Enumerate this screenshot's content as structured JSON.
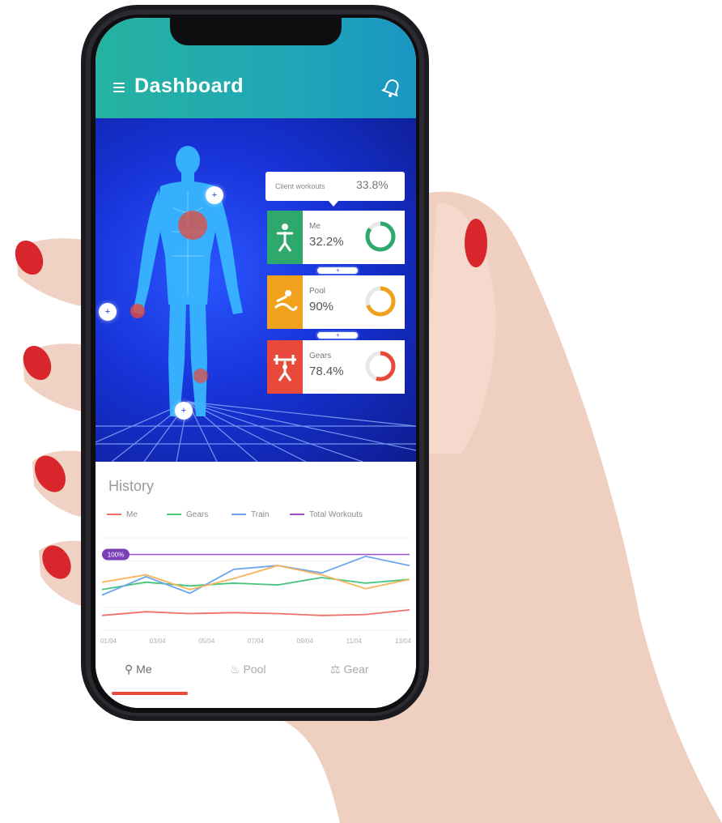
{
  "app": {
    "title": "Dashboard"
  },
  "header": {
    "menu_icon": "hamburger-menu-icon",
    "action_icon": "bell-icon"
  },
  "body_map": {
    "pins": [
      "+",
      "+",
      "+"
    ]
  },
  "tooltip": {
    "label": "Client workouts",
    "value": "33.8%"
  },
  "stats": [
    {
      "label": "Me",
      "value": "32.2%",
      "color": "#2ea86b",
      "icon": "figure-icon",
      "ring_fraction": 0.85
    },
    {
      "label": "Pool",
      "value": "90%",
      "color": "#f0a21c",
      "icon": "swimming-icon",
      "ring_fraction": 0.7
    },
    {
      "label": "Gears",
      "value": "78.4%",
      "color": "#e8493a",
      "icon": "weightlift-icon",
      "ring_fraction": 0.55
    }
  ],
  "connectors": [
    "+",
    "+"
  ],
  "history": {
    "title": "History",
    "legend": [
      {
        "name": "Me",
        "color": "#ef6f6a"
      },
      {
        "name": "Gears",
        "color": "#45c47a"
      },
      {
        "name": "Train",
        "color": "#6da6ee"
      },
      {
        "name": "Total Workouts",
        "color": "#9b4fc9"
      }
    ],
    "badge": "100%"
  },
  "chart_data": {
    "type": "line",
    "x": [
      "01/04",
      "03/04",
      "05/04",
      "07/04",
      "09/04",
      "11/04",
      "13/04"
    ],
    "series": [
      {
        "name": "Me",
        "values": [
          16,
          20,
          18,
          19,
          18,
          16,
          17,
          22
        ]
      },
      {
        "name": "Gears",
        "values": [
          44,
          52,
          48,
          51,
          49,
          57,
          51,
          55
        ]
      },
      {
        "name": "Train",
        "values": [
          38,
          58,
          40,
          66,
          70,
          62,
          80,
          70
        ]
      },
      {
        "name": "Total Workouts",
        "values": [
          82,
          82,
          82,
          82,
          82,
          82,
          82,
          82
        ]
      },
      {
        "name": "",
        "values": [
          52,
          60,
          44,
          56,
          70,
          60,
          45,
          55
        ]
      }
    ],
    "ylim": [
      0,
      100
    ],
    "xlabel": "",
    "ylabel": "",
    "grid": true
  },
  "nav": {
    "tabs": [
      {
        "label": "Me",
        "icon": "figure-icon"
      },
      {
        "label": "Pool",
        "icon": "swimming-icon"
      },
      {
        "label": "Gear",
        "icon": "weightlift-icon"
      }
    ]
  },
  "colors": {
    "appbar": "#1fa7b6",
    "hero": "#1733d8",
    "accent": "#e8493a"
  }
}
